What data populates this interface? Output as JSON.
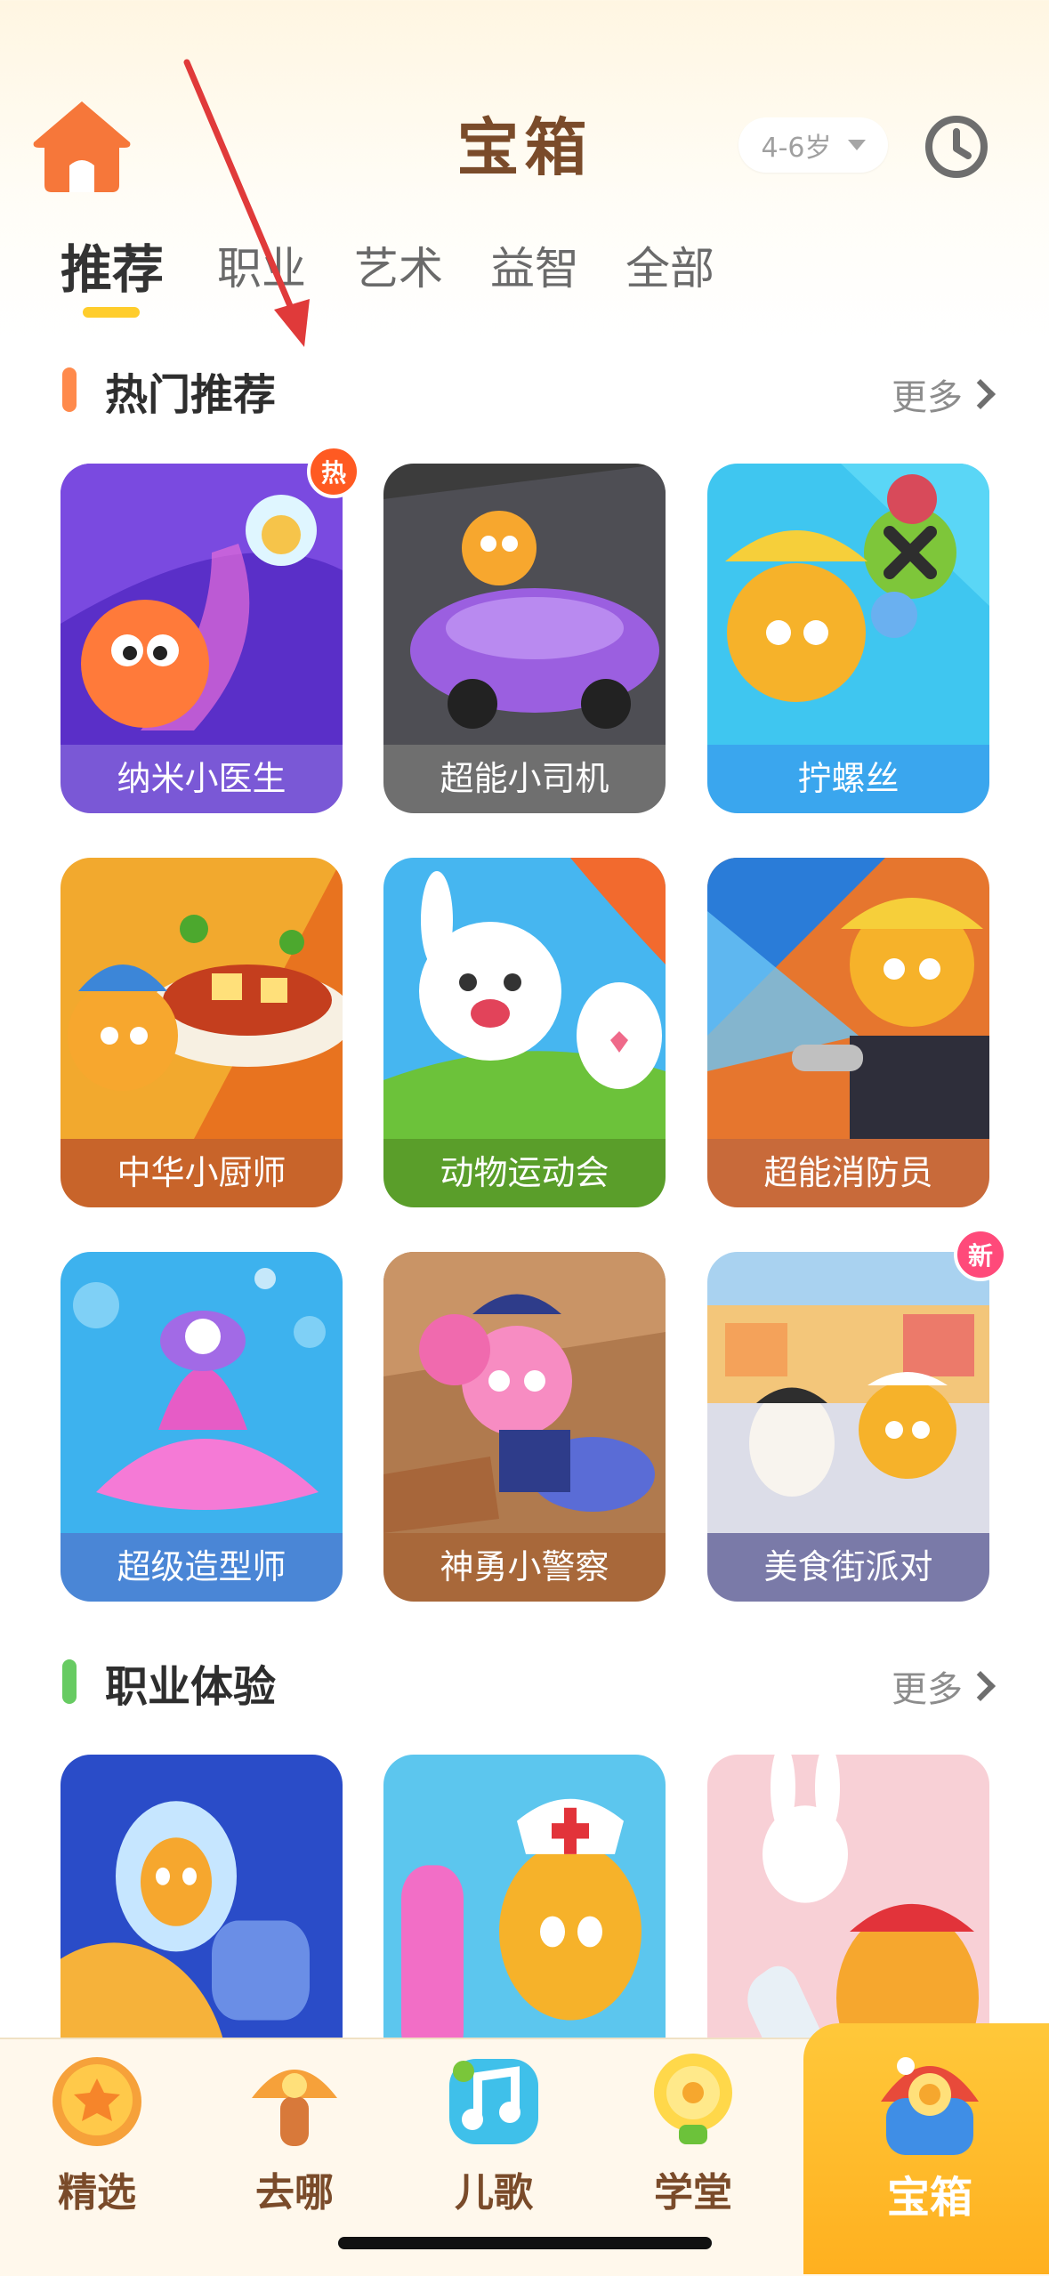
{
  "header": {
    "title": "宝箱",
    "age_filter": "4-6岁",
    "icons": [
      "home-icon",
      "clock-icon",
      "caret-down-icon"
    ]
  },
  "tabs": [
    {
      "label": "推荐",
      "active": true
    },
    {
      "label": "职业",
      "active": false
    },
    {
      "label": "艺术",
      "active": false
    },
    {
      "label": "益智",
      "active": false
    },
    {
      "label": "全部",
      "active": false
    }
  ],
  "sections": [
    {
      "title": "热门推荐",
      "more": "更多",
      "accent": "#ff8a4c",
      "cards": [
        {
          "name": "纳米小医生",
          "badge": "热",
          "label_color": "#7a58d6",
          "bg": "#6a3cd6"
        },
        {
          "name": "超能小司机",
          "badge": "",
          "label_color": "#6f6f6f",
          "bg": "#9c6ae0"
        },
        {
          "name": "拧螺丝",
          "badge": "",
          "label_color": "#3aa6ee",
          "bg": "#2cc2ee"
        },
        {
          "name": "中华小厨师",
          "badge": "",
          "label_color": "#c8642a",
          "bg": "#f08a2a"
        },
        {
          "name": "动物运动会",
          "badge": "",
          "label_color": "#5a9e2a",
          "bg": "#48b8f0"
        },
        {
          "name": "超能消防员",
          "badge": "",
          "label_color": "#c86a3a",
          "bg": "#e6762e"
        },
        {
          "name": "超级造型师",
          "badge": "",
          "label_color": "#4a86d6",
          "bg": "#3eb0ea"
        },
        {
          "name": "神勇小警察",
          "badge": "",
          "label_color": "#a8683a",
          "bg": "#c88a54"
        },
        {
          "name": "美食街派对",
          "badge": "新",
          "label_color": "#7a7aa8",
          "bg": "#a8c8ec"
        }
      ]
    },
    {
      "title": "职业体验",
      "more": "更多",
      "accent": "#67cb62",
      "cards": [
        {
          "name": "",
          "bg": "#2a58d0"
        },
        {
          "name": "",
          "bg": "#5bc6ee"
        },
        {
          "name": "",
          "bg": "#f6c6cc"
        }
      ]
    }
  ],
  "bottom_nav": [
    {
      "label": "精选",
      "icon": "star-bubble-icon"
    },
    {
      "label": "去哪",
      "icon": "mushroom-icon"
    },
    {
      "label": "儿歌",
      "icon": "music-note-icon"
    },
    {
      "label": "学堂",
      "icon": "bulb-icon"
    },
    {
      "label": "宝箱",
      "icon": "treasure-box-icon",
      "active": true
    }
  ],
  "colors": {
    "title_brown": "#7a4b2a",
    "accent_orange": "#ff8a4c",
    "tab_indicator": "#ffcd2c",
    "annotation_red": "#e03a3a"
  }
}
